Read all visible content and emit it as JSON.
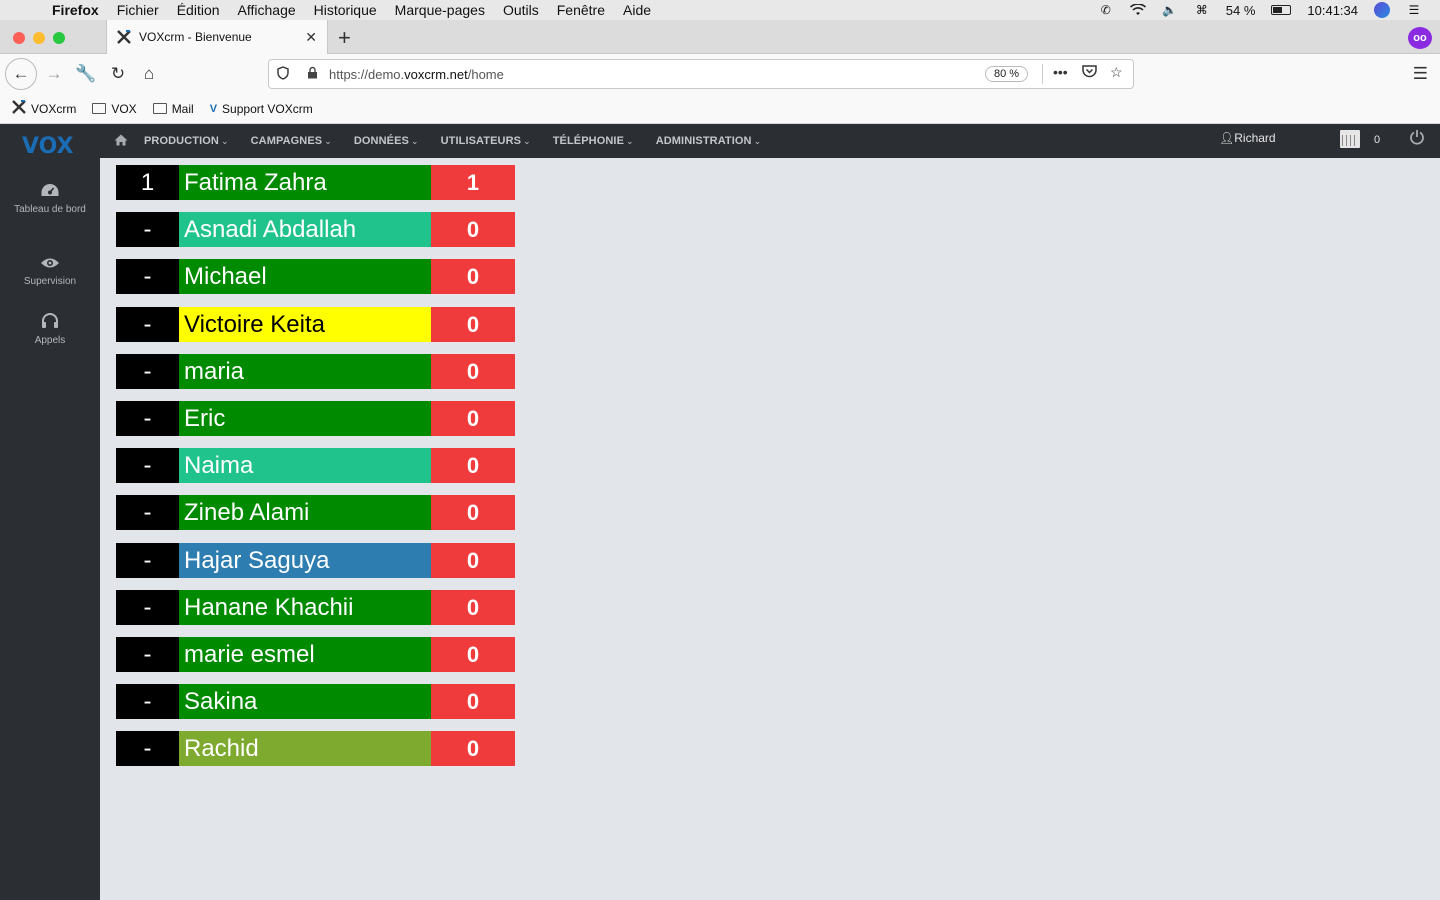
{
  "macos": {
    "app_name": "Firefox",
    "menus": [
      "Fichier",
      "Édition",
      "Affichage",
      "Historique",
      "Marque-pages",
      "Outils",
      "Fenêtre",
      "Aide"
    ],
    "battery_text": "54 %",
    "battery_level": 0.54,
    "clock": "10:41:34"
  },
  "browser": {
    "tab_title": "VOXcrm - Bienvenue",
    "url_prefix": "https://demo.",
    "url_domain": "voxcrm.net",
    "url_path": "/home",
    "zoom": "80 %",
    "bookmarks": [
      {
        "label": "VOXcrm",
        "icon": "voxcrm-favicon-icon"
      },
      {
        "label": "VOX",
        "icon": "folder-icon"
      },
      {
        "label": "Mail",
        "icon": "folder-icon"
      },
      {
        "label": "Support VOXcrm",
        "icon": "vox-logo-icon"
      }
    ]
  },
  "app": {
    "logo": "VOX",
    "sidebar": [
      {
        "label": "Tableau de bord",
        "icon": "dashboard-icon"
      },
      {
        "label": "Supervision",
        "icon": "eye-icon"
      },
      {
        "label": "Appels",
        "icon": "headset-icon"
      }
    ],
    "nav": [
      "PRODUCTION",
      "CAMPAGNES",
      "DONNÉES",
      "UTILISATEURS",
      "TÉLÉPHONIE",
      "ADMINISTRATION"
    ],
    "user": "Richard",
    "calendar_count": "0",
    "colors": {
      "green": "#008a00",
      "teal": "#20c38c",
      "yellow": "#ffff00",
      "blue": "#2e7db0",
      "olive": "#7faa30",
      "red": "#ef3b3b"
    },
    "agents": [
      {
        "rank": "1",
        "name": "Fatima Zahra",
        "count": "1",
        "color": "#008a00",
        "text_color": "#ffffff"
      },
      {
        "rank": "-",
        "name": "Asnadi Abdallah",
        "count": "0",
        "color": "#20c38c",
        "text_color": "#ffffff"
      },
      {
        "rank": "-",
        "name": "Michael",
        "count": "0",
        "color": "#008a00",
        "text_color": "#ffffff"
      },
      {
        "rank": "-",
        "name": "Victoire Keita",
        "count": "0",
        "color": "#ffff00",
        "text_color": "#000000"
      },
      {
        "rank": "-",
        "name": "maria",
        "count": "0",
        "color": "#008a00",
        "text_color": "#ffffff"
      },
      {
        "rank": "-",
        "name": "Eric",
        "count": "0",
        "color": "#008a00",
        "text_color": "#ffffff"
      },
      {
        "rank": "-",
        "name": "Naima",
        "count": "0",
        "color": "#20c38c",
        "text_color": "#ffffff"
      },
      {
        "rank": "-",
        "name": "Zineb Alami",
        "count": "0",
        "color": "#008a00",
        "text_color": "#ffffff"
      },
      {
        "rank": "-",
        "name": "Hajar Saguya",
        "count": "0",
        "color": "#2e7db0",
        "text_color": "#ffffff"
      },
      {
        "rank": "-",
        "name": "Hanane Khachii",
        "count": "0",
        "color": "#008a00",
        "text_color": "#ffffff"
      },
      {
        "rank": "-",
        "name": "marie esmel",
        "count": "0",
        "color": "#008a00",
        "text_color": "#ffffff"
      },
      {
        "rank": "-",
        "name": "Sakina",
        "count": "0",
        "color": "#008a00",
        "text_color": "#ffffff"
      },
      {
        "rank": "-",
        "name": "Rachid",
        "count": "0",
        "color": "#7faa30",
        "text_color": "#ffffff"
      }
    ]
  }
}
